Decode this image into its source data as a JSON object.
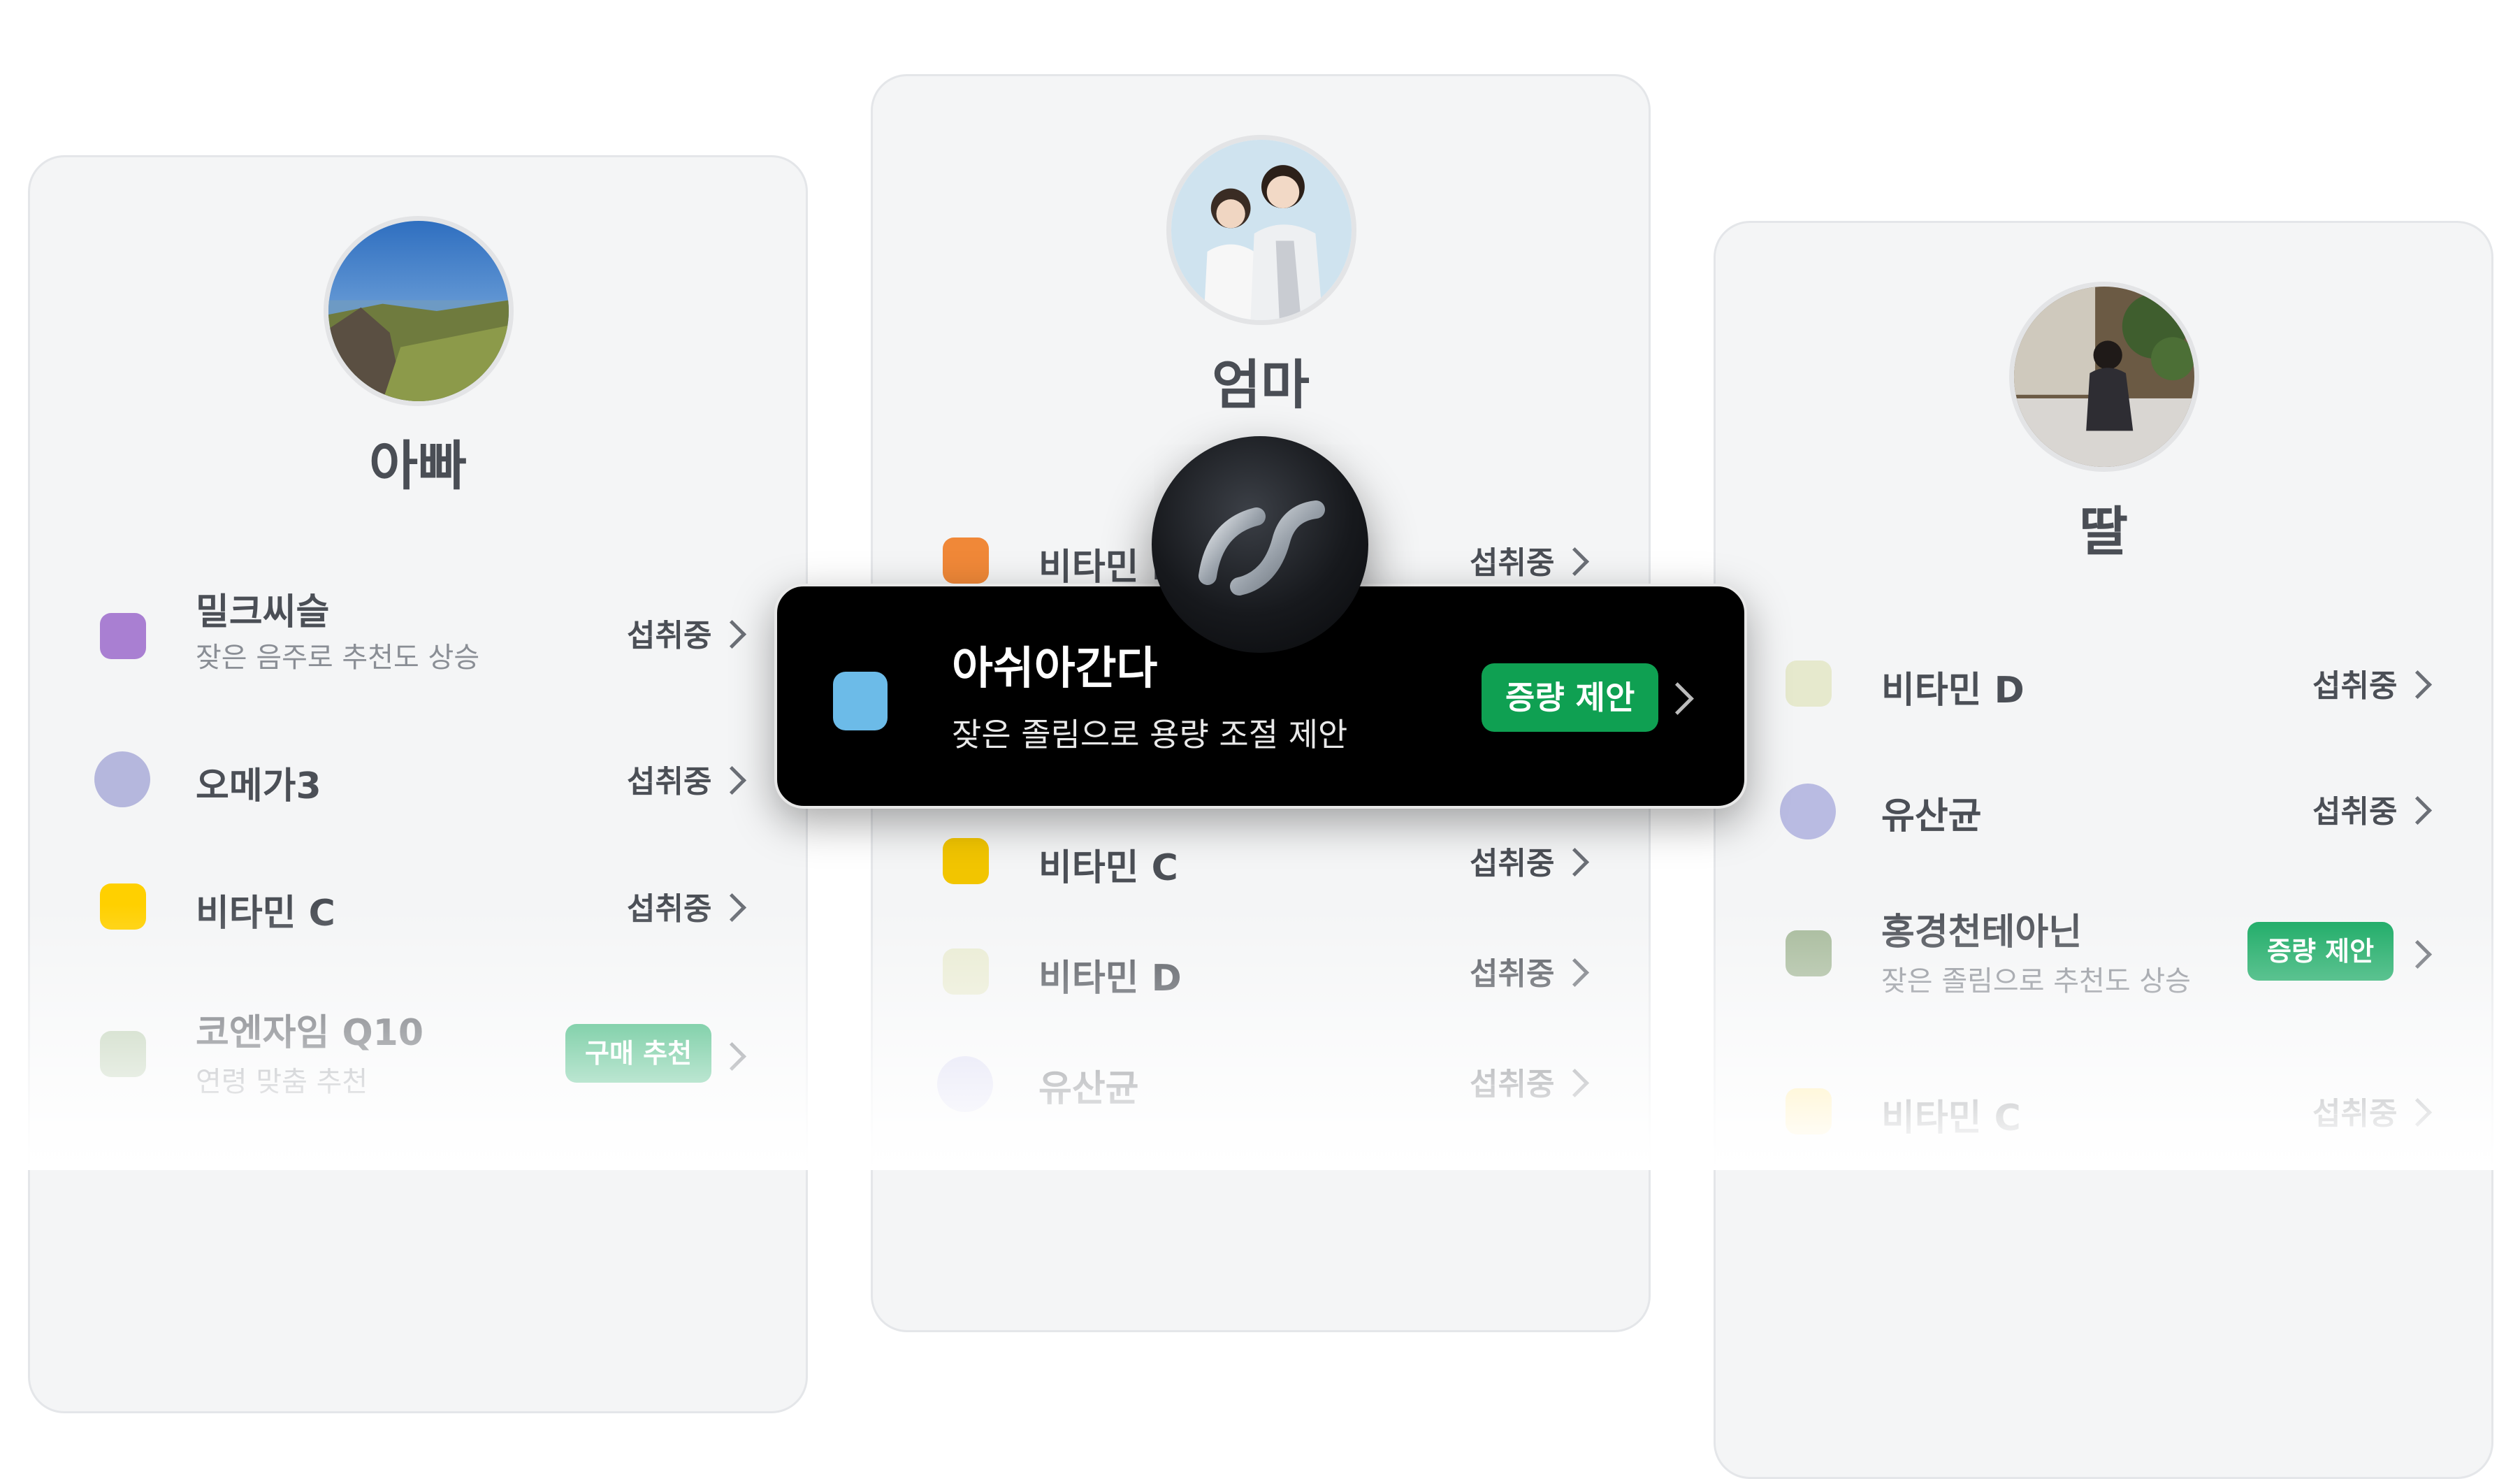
{
  "cards": [
    {
      "name": "아빠",
      "items": [
        {
          "label": "밀크씨슬",
          "sub": "잦은 음주로 추천도 상승",
          "status": "섭취중",
          "color": "#a97fd2",
          "shape": "square"
        },
        {
          "label": "오메가3",
          "status": "섭취중",
          "color": "#b5b7dd",
          "shape": "circle"
        },
        {
          "label": "비타민 C",
          "status": "섭취중",
          "color": "#ffd000",
          "shape": "square"
        },
        {
          "label": "코엔자임 Q10",
          "sub": "연령 맞춤 추천",
          "badge": "구매 추천",
          "color": "#b3c8a8",
          "shape": "square"
        }
      ]
    },
    {
      "name": "엄마",
      "items": [
        {
          "label": "비타민 I",
          "status": "섭취중",
          "color": "#f08838",
          "shape": "square"
        },
        {
          "label": "비타민 C",
          "status": "섭취중",
          "color": "#f2c500",
          "shape": "square"
        },
        {
          "label": "비타민 D",
          "status": "섭취중",
          "color": "#e8ead0",
          "shape": "square"
        },
        {
          "label": "유산균",
          "status": "섭취중",
          "color": "#d3d3ef",
          "shape": "circle"
        }
      ]
    },
    {
      "name": "딸",
      "items": [
        {
          "label": "비타민 D",
          "status": "섭취중",
          "color": "#e6e9cd",
          "shape": "square"
        },
        {
          "label": "유산균",
          "status": "섭취중",
          "color": "#b9bbe2",
          "shape": "circle"
        },
        {
          "label": "홍경천테아닌",
          "sub": "잦은 졸림으로 추천도 상승",
          "badge": "증량 제안",
          "color": "#a4b898",
          "shape": "square"
        },
        {
          "label": "비타민 C",
          "status": "섭취중",
          "color": "#ffe27a",
          "shape": "square"
        }
      ]
    }
  ],
  "popup": {
    "title": "아쉬아간다",
    "subtitle": "잦은 졸림으로 용량 조절 제안",
    "badge": "증량 제안",
    "color": "#6cbbe8"
  },
  "orb_icon": "link-icon"
}
